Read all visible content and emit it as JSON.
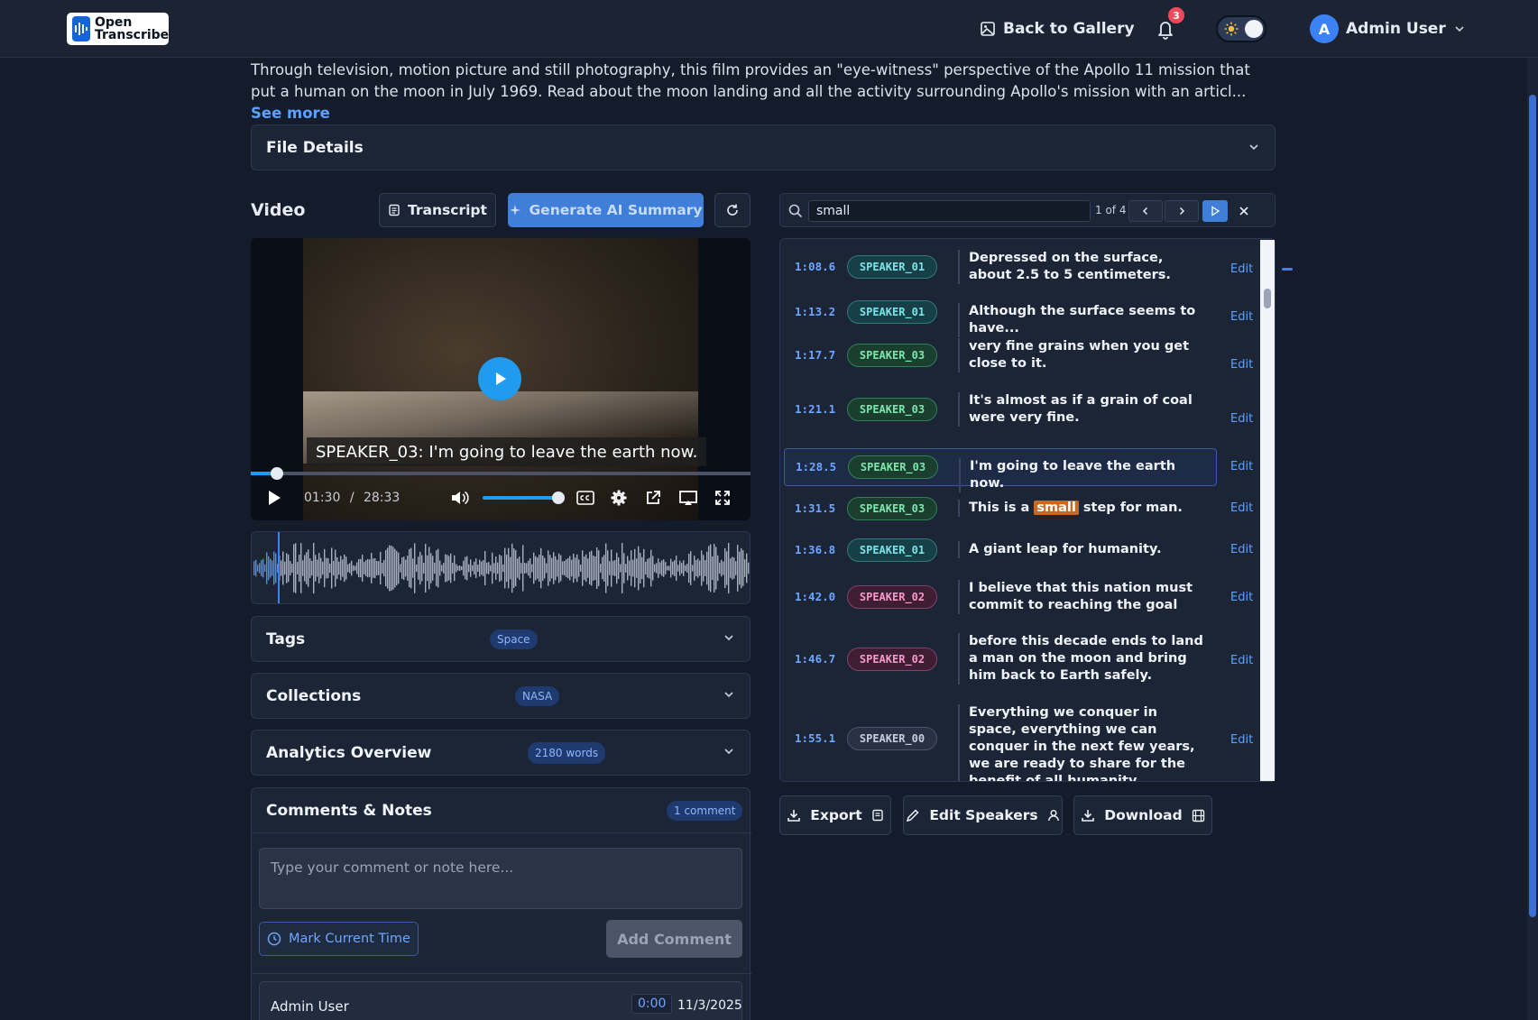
{
  "topbar": {
    "logo_line1": "Open",
    "logo_line2": "Transcribe",
    "back_label": "Back to Gallery",
    "notification_count": "3",
    "user_initial": "A",
    "user_name": "Admin User"
  },
  "description": {
    "text": "Through television, motion picture and still photography, this film provides an \"eye-witness\" perspective of the Apollo 11 mission that put a human on the moon in July 1969. Read about the moon landing and all the activity surrounding Apollo's mission with an articl...",
    "see_more": "See more"
  },
  "file_details": {
    "title": "File Details"
  },
  "video_section": {
    "title": "Video",
    "transcript_button": "Transcript",
    "summary_button": "Generate AI Summary",
    "caption": "SPEAKER_03: I'm going to leave the earth now.",
    "current_time": "01:30",
    "separator": "/",
    "duration": "28:33",
    "progress_fraction": 0.053,
    "volume_fraction": 0.9
  },
  "tags": {
    "title": "Tags",
    "chip": "Space"
  },
  "collections": {
    "title": "Collections",
    "chip": "NASA"
  },
  "analytics": {
    "title": "Analytics Overview",
    "chip": "2180 words"
  },
  "comments": {
    "title": "Comments & Notes",
    "count_chip": "1 comment",
    "placeholder": "Type your comment or note here...",
    "mark_time": "Mark Current Time",
    "add_comment": "Add Comment",
    "entry": {
      "author": "Admin User",
      "time": "0:00",
      "date": "11/3/2025"
    }
  },
  "search": {
    "query": "small",
    "result_count": "1 of 4"
  },
  "transcript": {
    "edit_label": "Edit",
    "rows": [
      {
        "time": "1:08.6",
        "speaker": "SPEAKER_01",
        "text": "Depressed on the surface, about 2.5 to 5 centimeters."
      },
      {
        "time": "1:13.2",
        "speaker": "SPEAKER_01",
        "text": "Although the surface seems to have..."
      },
      {
        "time": "1:17.7",
        "speaker": "SPEAKER_03",
        "text": "very fine grains when you get close to it."
      },
      {
        "time": "1:21.1",
        "speaker": "SPEAKER_03",
        "text": "It's almost as if a grain of coal were very fine."
      },
      {
        "time": "1:28.5",
        "speaker": "SPEAKER_03",
        "text": "I'm going to leave the earth now."
      },
      {
        "time": "1:31.5",
        "speaker": "SPEAKER_03",
        "text_before": "This is a",
        "text_highlight": "small",
        "text_after": "step for man."
      },
      {
        "time": "1:36.8",
        "speaker": "SPEAKER_01",
        "text": "A giant leap for humanity."
      },
      {
        "time": "1:42.0",
        "speaker": "SPEAKER_02",
        "text": "I believe that this nation must commit to reaching the goal"
      },
      {
        "time": "1:46.7",
        "speaker": "SPEAKER_02",
        "text": "before this decade ends to land a man on the moon and bring him back to Earth safely."
      },
      {
        "time": "1:55.1",
        "speaker": "SPEAKER_00",
        "text": "Everything we conquer in space, everything we can conquer in the next few years, we are ready to share for the benefit of all humanity."
      }
    ]
  },
  "actions": {
    "export": "Export",
    "edit_speakers": "Edit Speakers",
    "download": "Download"
  },
  "colors": {
    "accent": "#3b82f6",
    "highlight": "#c96a24",
    "background": "#141c2b"
  }
}
